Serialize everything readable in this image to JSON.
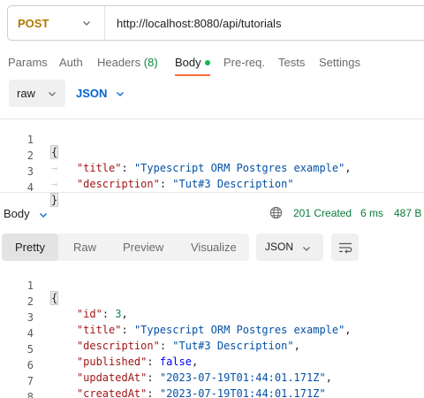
{
  "request": {
    "method": "POST",
    "url": "http://localhost:8080/api/tutorials"
  },
  "request_tabs": [
    {
      "label": "Params"
    },
    {
      "label": "Auth"
    },
    {
      "label": "Headers",
      "count": "(8)"
    },
    {
      "label": "Body"
    },
    {
      "label": "Pre-req."
    },
    {
      "label": "Tests"
    },
    {
      "label": "Settings"
    }
  ],
  "body_options": {
    "mode": "raw",
    "language": "JSON"
  },
  "request_body": {
    "line_numbers": [
      "1",
      "2",
      "3",
      "4"
    ],
    "open_brace": "{",
    "close_brace": "}",
    "fields": [
      {
        "key": "\"title\"",
        "value": "\"Typescript ORM Postgres example\"",
        "suffix": ","
      },
      {
        "key": "\"description\"",
        "value": "\"Tut#3 Description\"",
        "suffix": ""
      }
    ]
  },
  "response": {
    "body_label": "Body",
    "status": "201 Created",
    "time": "6 ms",
    "size": "487 B",
    "view_tabs": [
      "Pretty",
      "Raw",
      "Preview",
      "Visualize"
    ],
    "format": "JSON"
  },
  "response_body": {
    "line_numbers": [
      "1",
      "2",
      "3",
      "4",
      "5",
      "6",
      "7",
      "8"
    ],
    "open_brace": "{",
    "close_brace": "}",
    "fields": [
      {
        "key": "\"id\"",
        "value": "3",
        "suffix": ",",
        "type": "number"
      },
      {
        "key": "\"title\"",
        "value": "\"Typescript ORM Postgres example\"",
        "suffix": ",",
        "type": "string"
      },
      {
        "key": "\"description\"",
        "value": "\"Tut#3 Description\"",
        "suffix": ",",
        "type": "string"
      },
      {
        "key": "\"published\"",
        "value": "false",
        "suffix": ",",
        "type": "bool"
      },
      {
        "key": "\"updatedAt\"",
        "value": "\"2023-07-19T01:44:01.171Z\"",
        "suffix": ",",
        "type": "string"
      },
      {
        "key": "\"createdAt\"",
        "value": "\"2023-07-19T01:44:01.171Z\"",
        "suffix": "",
        "type": "string"
      }
    ]
  },
  "colors": {
    "method": "#ad7a03",
    "accent_underline": "#ff6c37",
    "status_green": "#0b7a3a",
    "link_blue": "#0265d2"
  },
  "icons": {
    "method_dropdown": "chevron-down-icon",
    "body_status": "green-dot",
    "network": "globe-icon",
    "wrap": "wrap-lines-icon"
  }
}
